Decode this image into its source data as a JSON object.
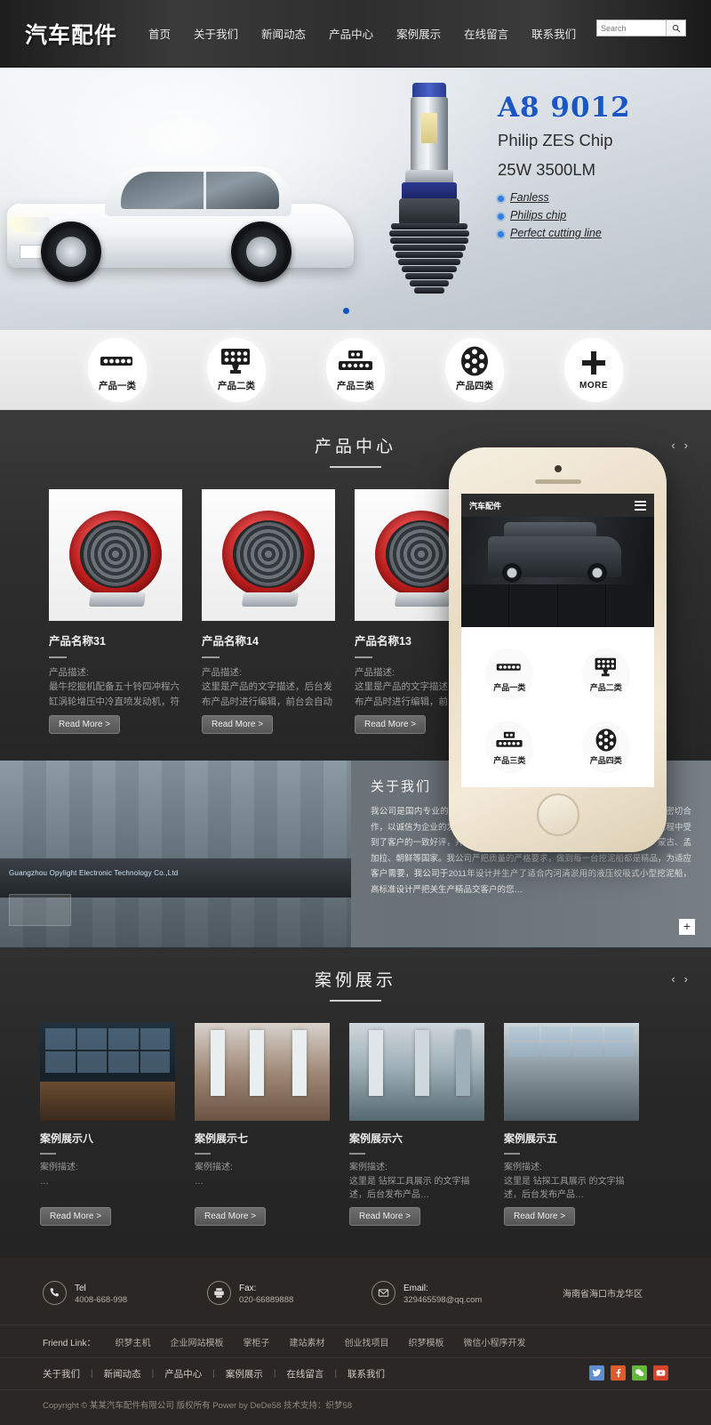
{
  "header": {
    "logo": "汽车配件",
    "nav": [
      {
        "label": "首页"
      },
      {
        "label": "关于我们"
      },
      {
        "label": "新闻动态"
      },
      {
        "label": "产品中心"
      },
      {
        "label": "案例展示"
      },
      {
        "label": "在线留言"
      },
      {
        "label": "联系我们"
      }
    ],
    "search_placeholder": "Search",
    "search_value": ""
  },
  "hero": {
    "title": "A8 9012",
    "subtitle_line1": "Philip ZES Chip",
    "subtitle_line2": "25W 3500LM",
    "features": [
      "Fanless",
      "Philips chip",
      "Perfect cutting line"
    ],
    "title_color": "#1a56c4",
    "dot_color": "#0d55c4",
    "active_slide": 1
  },
  "categories": [
    {
      "label": "产品一类",
      "icon": "led-bar-icon"
    },
    {
      "label": "产品二类",
      "icon": "led-grid-icon"
    },
    {
      "label": "产品三类",
      "icon": "led-stack-icon"
    },
    {
      "label": "产品四类",
      "icon": "led-round-icon"
    },
    {
      "label": "MORE",
      "icon": "plus-icon"
    }
  ],
  "products": {
    "title": "产品中心",
    "prev": "‹",
    "next": "›",
    "read_more": "Read More >",
    "items": [
      {
        "name": "产品名称31",
        "desc_label": "产品描述:",
        "desc": "最牛挖掘机配备五十铃四冲程六缸涡轮增压中冷直喷发动机，符合国三排放标准…"
      },
      {
        "name": "产品名称14",
        "desc_label": "产品描述:",
        "desc": "这里是产品的文字描述，后台发布产品时进行编辑，前台会自动调用！这里是…"
      },
      {
        "name": "产品名称13",
        "desc_label": "产品描述:",
        "desc": "这里是产品的文字描述，后台发布产品时进行编辑，前台会自动调用！这里是…"
      }
    ]
  },
  "about": {
    "title": "关于我们",
    "sign_text": "Guangzhou Opylight Electronic Technology Co.,Ltd",
    "body": "我公司是国内专业的挖泥船生产厂家之一，与国内著名的科研院所、高等院校密切合作，以诚信为企业的发展之本，以质量占定了稳固的挖泥船市场，产品在使用过程中受到了客户的一致好评，并打入国际市场，成功出口到尼日利亚、印度尼西亚、蒙古、孟加拉、朝鲜等国家。我公司严把质量的严格要求，做到每一台挖泥船都是精品，为适应客户需要，我公司于2011年设计并生产了适合内河清淤用的液压绞吸式小型挖泥船，高标准设计严把关生产精品交客户的您…",
    "expand": "+"
  },
  "phone": {
    "logo": "汽车配件",
    "categories": [
      {
        "label": "产品一类"
      },
      {
        "label": "产品二类"
      },
      {
        "label": "产品三类"
      },
      {
        "label": "产品四类"
      }
    ]
  },
  "cases": {
    "title": "案例展示",
    "prev": "‹",
    "next": "›",
    "read_more": "Read More >",
    "items": [
      {
        "name": "案例展示八",
        "desc_label": "案例描述:",
        "desc": "…"
      },
      {
        "name": "案例展示七",
        "desc_label": "案例描述:",
        "desc": "…"
      },
      {
        "name": "案例展示六",
        "desc_label": "案例描述:",
        "desc": "这里是 钻探工具展示 的文字描述，后台发布产品…"
      },
      {
        "name": "案例展示五",
        "desc_label": "案例描述:",
        "desc": "这里是 钻探工具展示 的文字描述，后台发布产品…"
      }
    ]
  },
  "footer": {
    "contacts": [
      {
        "icon": "phone-icon",
        "label": "Tel",
        "value": "4008-668-998"
      },
      {
        "icon": "fax-icon",
        "label": "Fax:",
        "value": "020-66889888"
      },
      {
        "icon": "mail-icon",
        "label": "Email:",
        "value": "329465598@qq.com"
      }
    ],
    "address": "海南省海口市龙华区",
    "friend_label": "Friend Link：",
    "friend_links": [
      "织梦主机",
      "企业网站模板",
      "掌柜子",
      "建站素材",
      "创业找项目",
      "织梦模板",
      "微信小程序开发"
    ],
    "bottom_nav": [
      "关于我们",
      "新闻动态",
      "产品中心",
      "案例展示",
      "在线留言",
      "联系我们"
    ],
    "separator": "|",
    "socials": [
      {
        "name": "twitter-icon",
        "color": "#5d8fd0"
      },
      {
        "name": "facebook-icon",
        "color": "#e05b2b"
      },
      {
        "name": "wechat-icon",
        "color": "#63b838"
      },
      {
        "name": "youtube-icon",
        "color": "#d6422a"
      }
    ],
    "copyright": "Copyright © 某某汽车配件有限公司 版权所有 Power by DeDe58 技术支持：织梦58"
  }
}
